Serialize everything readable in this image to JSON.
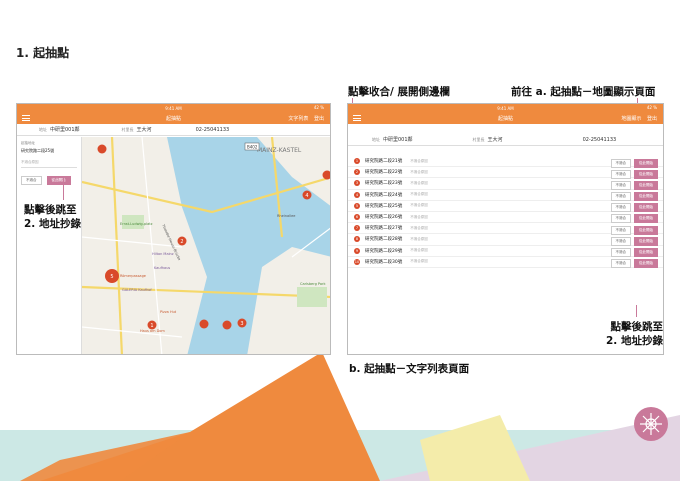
{
  "heading": "1. 起抽點",
  "annotations": {
    "toggle_sidebar": "點擊收合/ 展開側邊欄",
    "goto_map": "前往 a. 起抽點－地圖顯示頁面",
    "jump_left": [
      "點擊後跳至",
      "2. 地址抄錄"
    ],
    "jump_right": [
      "點擊後跳至",
      "2. 地址抄錄"
    ],
    "caption_b": "b. 起抽點－文字列表頁面"
  },
  "status": {
    "time": "9:41 AM",
    "battery": "42 %"
  },
  "nav": {
    "title": "起抽點",
    "text_list": "文字列表",
    "map_view": "地圖顯示",
    "logout": "登出"
  },
  "info": {
    "address_label": "地址",
    "address": "中研里001鄰",
    "owner_label": "村里長",
    "owner": "王大河",
    "phone": "02-25041133"
  },
  "sidebar": {
    "label": "起抽地址",
    "value": "研究院路二段25號",
    "placeholder": "不適合原因",
    "btn_unsuitable": "不適合",
    "btn_start": "從此開始"
  },
  "map": {
    "place1": "MAINZ-KASTEL",
    "road1": "Theodor-Heuss-Brücke",
    "road2": "Rheinallee",
    "park": "Ernst-Ludwig-platz",
    "shop1": "Kaufhaus",
    "shop2": "Hilton Mainz",
    "shop3": "Pizza Hut",
    "shop4": "Sandwiches",
    "shop5": "Haus am Dom",
    "shop6": "Römerpassage",
    "shop7": "GALERIA Kaufhof",
    "shop8": "Mainzer",
    "park2": "Carlsberg Park",
    "road_sign": "B402"
  },
  "list": {
    "note": "不適合原因",
    "btn_unsuitable": "不適合",
    "btn_start": "從此開始",
    "rows": [
      {
        "n": "1",
        "addr": "研究院路二段21號"
      },
      {
        "n": "2",
        "addr": "研究院路二段22號"
      },
      {
        "n": "3",
        "addr": "研究院路二段23號"
      },
      {
        "n": "4",
        "addr": "研究院路二段24號"
      },
      {
        "n": "5",
        "addr": "研究院路二段25號"
      },
      {
        "n": "6",
        "addr": "研究院路二段26號"
      },
      {
        "n": "7",
        "addr": "研究院路二段27號"
      },
      {
        "n": "8",
        "addr": "研究院路二段28號"
      },
      {
        "n": "9",
        "addr": "研究院路二段29號"
      },
      {
        "n": "10",
        "addr": "研究院路二段30號"
      }
    ]
  },
  "colors": {
    "orange": "#ef8a3e",
    "pink": "#c9799a",
    "pin": "#d94a2a",
    "river": "#a8d4e8"
  }
}
